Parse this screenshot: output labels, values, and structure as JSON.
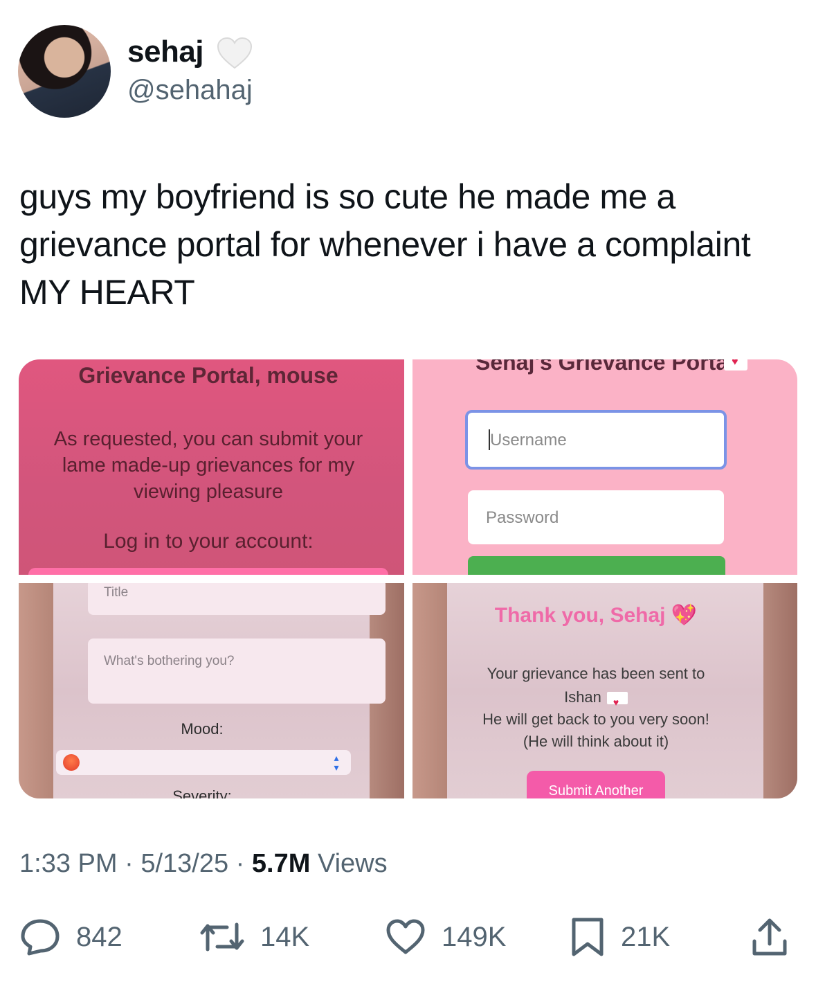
{
  "author": {
    "name": "sehaj",
    "handle": "@sehahaj"
  },
  "tweet": {
    "lines": [
      "guys my boyfriend is so cute he made me a",
      "grievance portal for whenever i have a complaint",
      "MY HEART"
    ]
  },
  "images": {
    "panel1": {
      "title": "Grievance Portal, mouse",
      "body": "As requested, you can submit your lame made-up grievances for my viewing pleasure",
      "login_label": "Log in to your account:"
    },
    "panel2": {
      "title": "Sehaj's Grievance Portal",
      "username_placeholder": "Username",
      "password_placeholder": "Password"
    },
    "panel3": {
      "title_placeholder": "Title",
      "bothering_placeholder": "What's bothering you?",
      "mood_label": "Mood:",
      "severity_label": "Severity:"
    },
    "panel4": {
      "thank_you": "Thank you, Sehaj 💖",
      "sent_line1": "Your grievance has been sent to",
      "sent_line2": "Ishan",
      "back_line1": "He will get back to you very soon!",
      "back_line2": "(He will think about it)",
      "submit_another": "Submit Another"
    }
  },
  "meta": {
    "time": "1:33 PM",
    "date": "5/13/25",
    "views_count": "5.7M",
    "views_label": "Views"
  },
  "actions": {
    "replies": "842",
    "reposts": "14K",
    "likes": "149K",
    "bookmarks": "21K"
  },
  "colors": {
    "text": "#0f1419",
    "secondary": "#536471",
    "panel1_bg": "#d9567e",
    "panel2_bg": "#fbb2c6",
    "login_button": "#4caf50",
    "submit_button": "#f45ba9"
  }
}
